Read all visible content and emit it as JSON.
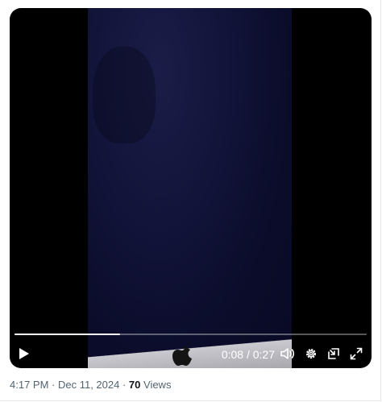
{
  "player": {
    "playback_progress_fraction": 0.3,
    "current_time": "0:08",
    "separator": " / ",
    "duration": "0:27",
    "icons": {
      "play": "play-icon",
      "volume": "volume-icon",
      "settings": "gear-icon",
      "pip": "picture-in-picture-icon",
      "fullscreen": "fullscreen-icon",
      "video_logo": "apple-logo-icon"
    }
  },
  "post_meta": {
    "time": "4:17 PM",
    "dot1": " · ",
    "date": "Dec 11, 2024",
    "dot2": " · ",
    "views_count": "70",
    "views_label": " Views"
  },
  "colors": {
    "player_bg": "#000000",
    "meta_text": "#536471",
    "views_text": "#0f1419"
  }
}
